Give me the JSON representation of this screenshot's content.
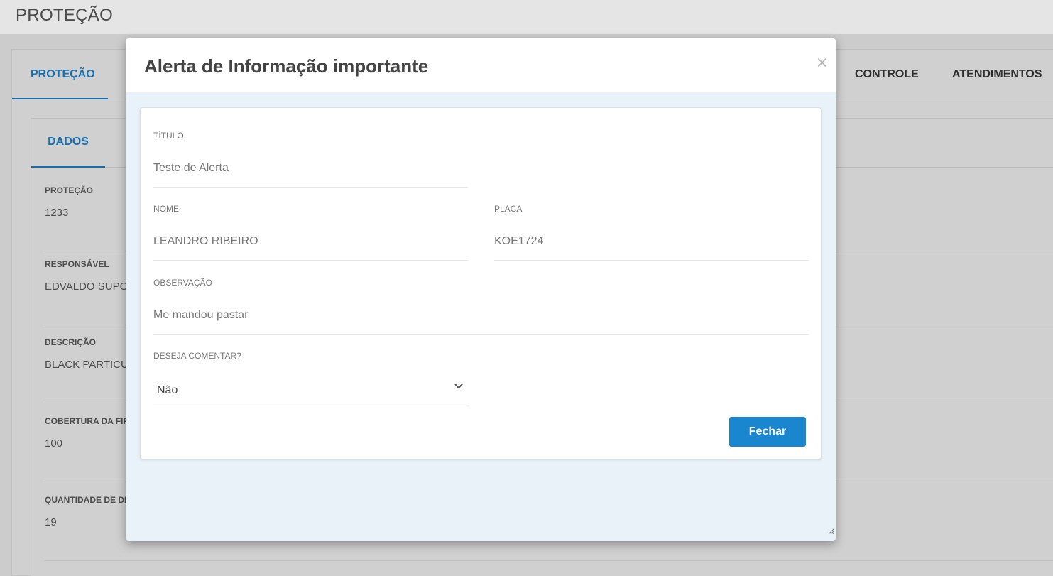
{
  "page": {
    "title": "PROTEÇÃO"
  },
  "outer_tabs": [
    {
      "label": "PROTEÇÃO",
      "active": true
    },
    {
      "label": "CONTROLE",
      "active": false
    },
    {
      "label": "ATENDIMENTOS",
      "active": false
    }
  ],
  "inner_tabs": [
    {
      "label": "DADOS",
      "active": true
    }
  ],
  "fields": [
    {
      "label": "PROTEÇÃO",
      "value": "1233"
    },
    {
      "label": "RESPONSÁVEL",
      "value": "EDVALDO SUPO"
    },
    {
      "label": "DESCRIÇÃO",
      "value": "BLACK PARTICU"
    },
    {
      "label": "COBERTURA DA FIP",
      "value": "100"
    },
    {
      "label": "QUANTIDADE DE DI",
      "value": "19"
    }
  ],
  "modal": {
    "title": "Alerta de Informação importante",
    "close_glyph": "×",
    "titulo": {
      "label": "TÍTULO",
      "value": "Teste de Alerta"
    },
    "nome": {
      "label": "NOME",
      "value": "LEANDRO RIBEIRO"
    },
    "placa": {
      "label": "PLACA",
      "value": "KOE1724"
    },
    "observacao": {
      "label": "OBSERVAÇÃO",
      "value": "Me mandou pastar"
    },
    "comentar": {
      "label": "DESEJA COMENTAR?",
      "selected": "Não"
    },
    "close_button": "Fechar"
  },
  "colors": {
    "accent": "#1a7cc1",
    "button": "#1a86d0",
    "modal_bg": "#eaf2f9"
  }
}
